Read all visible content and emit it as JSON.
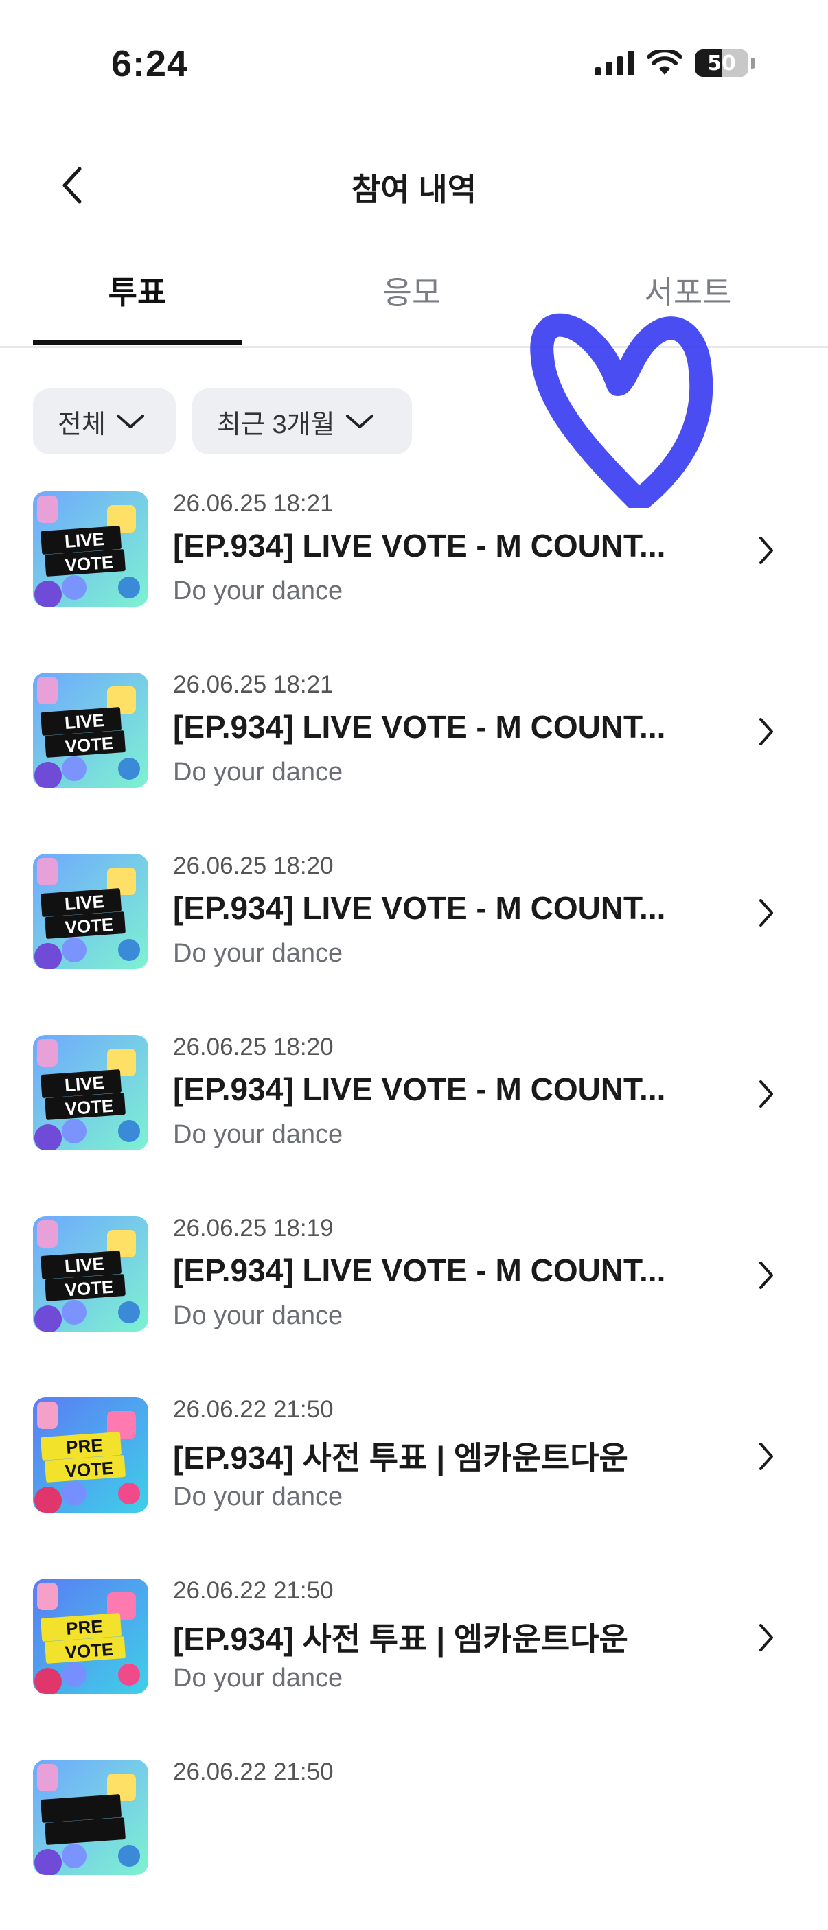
{
  "status_bar": {
    "time": "6:24",
    "battery": "50",
    "battery_level": 0.5
  },
  "header": {
    "title": "참여 내역",
    "back_icon": "chevron-left-icon"
  },
  "tabs": [
    {
      "label": "투표",
      "active": true
    },
    {
      "label": "응모",
      "active": false
    },
    {
      "label": "서포트",
      "active": false
    }
  ],
  "filters": [
    {
      "label": "전체",
      "icon": "chevron-down-icon"
    },
    {
      "label": "최근 3개월",
      "icon": "chevron-down-icon"
    }
  ],
  "items": [
    {
      "date": "26.06.25 18:21",
      "title": "[EP.934] LIVE VOTE - M COUNT...",
      "subtitle": "Do your dance",
      "badge_top": "LIVE",
      "badge_bottom": "VOTE"
    },
    {
      "date": "26.06.25 18:21",
      "title": "[EP.934] LIVE VOTE - M COUNT...",
      "subtitle": "Do your dance",
      "badge_top": "LIVE",
      "badge_bottom": "VOTE"
    },
    {
      "date": "26.06.25 18:20",
      "title": "[EP.934] LIVE VOTE - M COUNT...",
      "subtitle": "Do your dance",
      "badge_top": "LIVE",
      "badge_bottom": "VOTE"
    },
    {
      "date": "26.06.25 18:20",
      "title": "[EP.934] LIVE VOTE - M COUNT...",
      "subtitle": "Do your dance",
      "badge_top": "LIVE",
      "badge_bottom": "VOTE"
    },
    {
      "date": "26.06.25 18:19",
      "title": "[EP.934] LIVE VOTE - M COUNT...",
      "subtitle": "Do your dance",
      "badge_top": "LIVE",
      "badge_bottom": "VOTE"
    },
    {
      "date": "26.06.22 21:50",
      "title": "[EP.934] 사전 투표 | 엠카운트다운",
      "subtitle": "Do your dance",
      "badge_top": "PRE",
      "badge_bottom": "VOTE"
    },
    {
      "date": "26.06.22 21:50",
      "title": "[EP.934] 사전 투표 | 엠카운트다운",
      "subtitle": "Do your dance",
      "badge_top": "PRE",
      "badge_bottom": "VOTE"
    },
    {
      "date": "26.06.22 21:50",
      "title": "",
      "subtitle": "",
      "badge_top": "",
      "badge_bottom": ""
    }
  ],
  "colors": {
    "active_tab": "#111111",
    "inactive_tab": "#7a7d84",
    "chip_bg": "#eeeff2",
    "heart_scribble": "#2a2ff0",
    "live_thumb_bg": "#3fd0e0",
    "pre_thumb_bg": "#4a6cf0",
    "pre_badge": "#f2e22b"
  }
}
